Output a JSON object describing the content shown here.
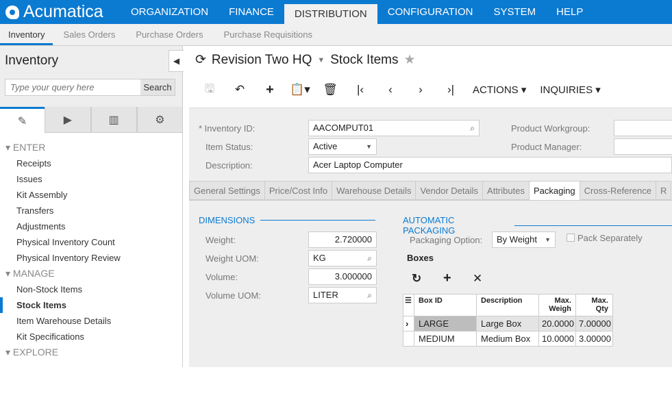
{
  "app": {
    "logo": "Acumatica",
    "menu": [
      "ORGANIZATION",
      "FINANCE",
      "DISTRIBUTION",
      "CONFIGURATION",
      "SYSTEM",
      "HELP"
    ],
    "active_menu": "DISTRIBUTION"
  },
  "subnav": [
    "Inventory",
    "Sales Orders",
    "Purchase Orders",
    "Purchase Requisitions"
  ],
  "sidebar": {
    "title": "Inventory",
    "search_placeholder": "Type your query here",
    "search_button": "Search",
    "groups": [
      {
        "label": "ENTER",
        "items": [
          "Receipts",
          "Issues",
          "Kit Assembly",
          "Transfers",
          "Adjustments",
          "Physical Inventory Count",
          "Physical Inventory Review"
        ]
      },
      {
        "label": "MANAGE",
        "items": [
          "Non-Stock Items",
          "Stock Items",
          "Item Warehouse Details",
          "Kit Specifications"
        ]
      },
      {
        "label": "EXPLORE",
        "items": []
      }
    ],
    "active_item": "Stock Items"
  },
  "header": {
    "company": "Revision Two HQ",
    "screen": "Stock Items"
  },
  "toolbar": {
    "actions": "ACTIONS",
    "inquiries": "INQUIRIES"
  },
  "form": {
    "inventory_id_label": "* Inventory ID:",
    "inventory_id": "AACOMPUT01",
    "item_status_label": "Item Status:",
    "item_status": "Active",
    "description_label": "Description:",
    "description": "Acer Laptop Computer",
    "workgroup_label": "Product Workgroup:",
    "manager_label": "Product Manager:"
  },
  "tabs": [
    "General Settings",
    "Price/Cost Info",
    "Warehouse Details",
    "Vendor Details",
    "Attributes",
    "Packaging",
    "Cross-Reference",
    "R"
  ],
  "active_tab": "Packaging",
  "dimensions": {
    "title": "DIMENSIONS",
    "weight_label": "Weight:",
    "weight": "2.720000",
    "weight_uom_label": "Weight UOM:",
    "weight_uom": "KG",
    "volume_label": "Volume:",
    "volume": "3.000000",
    "volume_uom_label": "Volume UOM:",
    "volume_uom": "LITER"
  },
  "packaging": {
    "title": "AUTOMATIC PACKAGING",
    "option_label": "Packaging Option:",
    "option": "By Weight",
    "pack_separately": "Pack Separately",
    "pack_separately_checked": false,
    "boxes_title": "Boxes",
    "columns": [
      "Box ID",
      "Description",
      "Max. Weigh",
      "Max. Qty"
    ],
    "rows": [
      {
        "id": "LARGE",
        "desc": "Large Box",
        "weight": "20.0000",
        "qty": "7.00000"
      },
      {
        "id": "MEDIUM",
        "desc": "Medium Box",
        "weight": "10.0000",
        "qty": "3.00000"
      }
    ]
  },
  "colors": {
    "brand": "#0b7ad1"
  }
}
